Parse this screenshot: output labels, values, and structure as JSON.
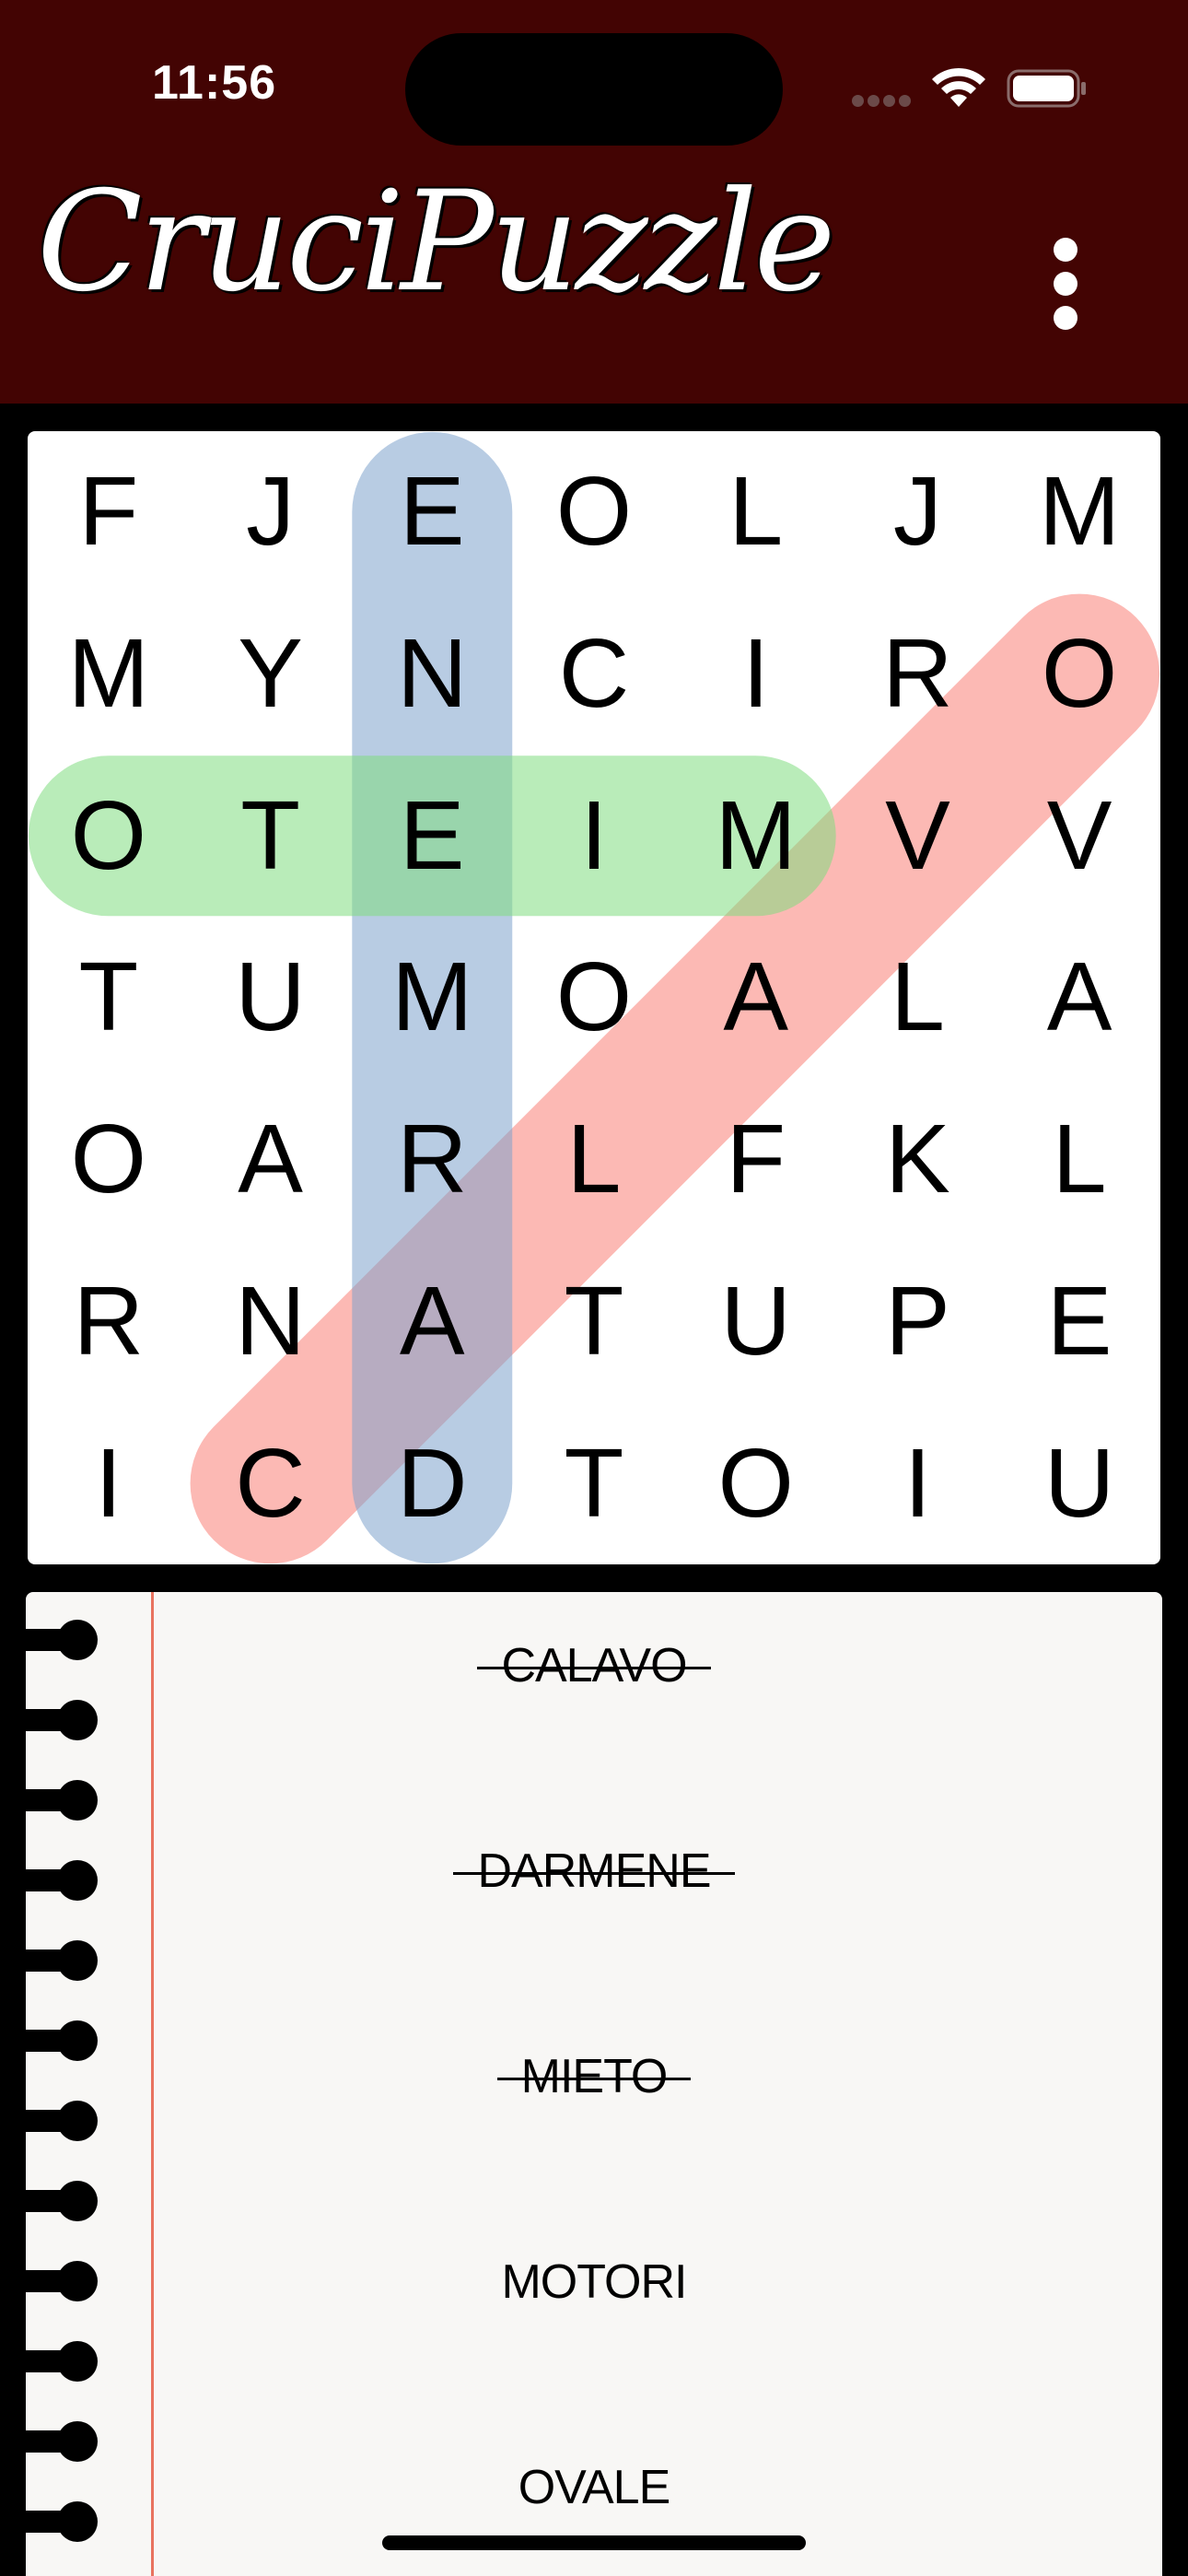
{
  "status_bar": {
    "time": "11:56"
  },
  "header": {
    "title": "CruciPuzzle",
    "background_color": "#430403",
    "menu_icon": "vertical-ellipsis-icon"
  },
  "board": {
    "rows": 7,
    "cols": 7,
    "letters": [
      [
        "F",
        "J",
        "E",
        "O",
        "L",
        "J",
        "M"
      ],
      [
        "M",
        "Y",
        "N",
        "C",
        "I",
        "R",
        "O"
      ],
      [
        "O",
        "T",
        "E",
        "I",
        "M",
        "V",
        "V"
      ],
      [
        "T",
        "U",
        "M",
        "O",
        "A",
        "L",
        "A"
      ],
      [
        "O",
        "A",
        "R",
        "L",
        "F",
        "K",
        "L"
      ],
      [
        "R",
        "N",
        "A",
        "T",
        "U",
        "P",
        "E"
      ],
      [
        "I",
        "C",
        "D",
        "T",
        "O",
        "I",
        "U"
      ]
    ],
    "found_highlights": [
      {
        "word": "CALAVO",
        "color": "#f97f77",
        "opacity": 0.55,
        "start": [
          6,
          1
        ],
        "end": [
          1,
          6
        ]
      },
      {
        "word": "DARMENE",
        "color": "#7ea3cc",
        "opacity": 0.55,
        "start": [
          6,
          2
        ],
        "end": [
          0,
          2
        ]
      },
      {
        "word": "MIETO",
        "color": "#80dc7f",
        "opacity": 0.55,
        "start": [
          2,
          4
        ],
        "end": [
          2,
          0
        ]
      }
    ]
  },
  "word_list": {
    "words": [
      {
        "text": "CALAVO",
        "found": true
      },
      {
        "text": "DARMENE",
        "found": true
      },
      {
        "text": "MIETO",
        "found": true
      },
      {
        "text": "MOTORI",
        "found": false
      },
      {
        "text": "OVALE",
        "found": false
      }
    ]
  }
}
